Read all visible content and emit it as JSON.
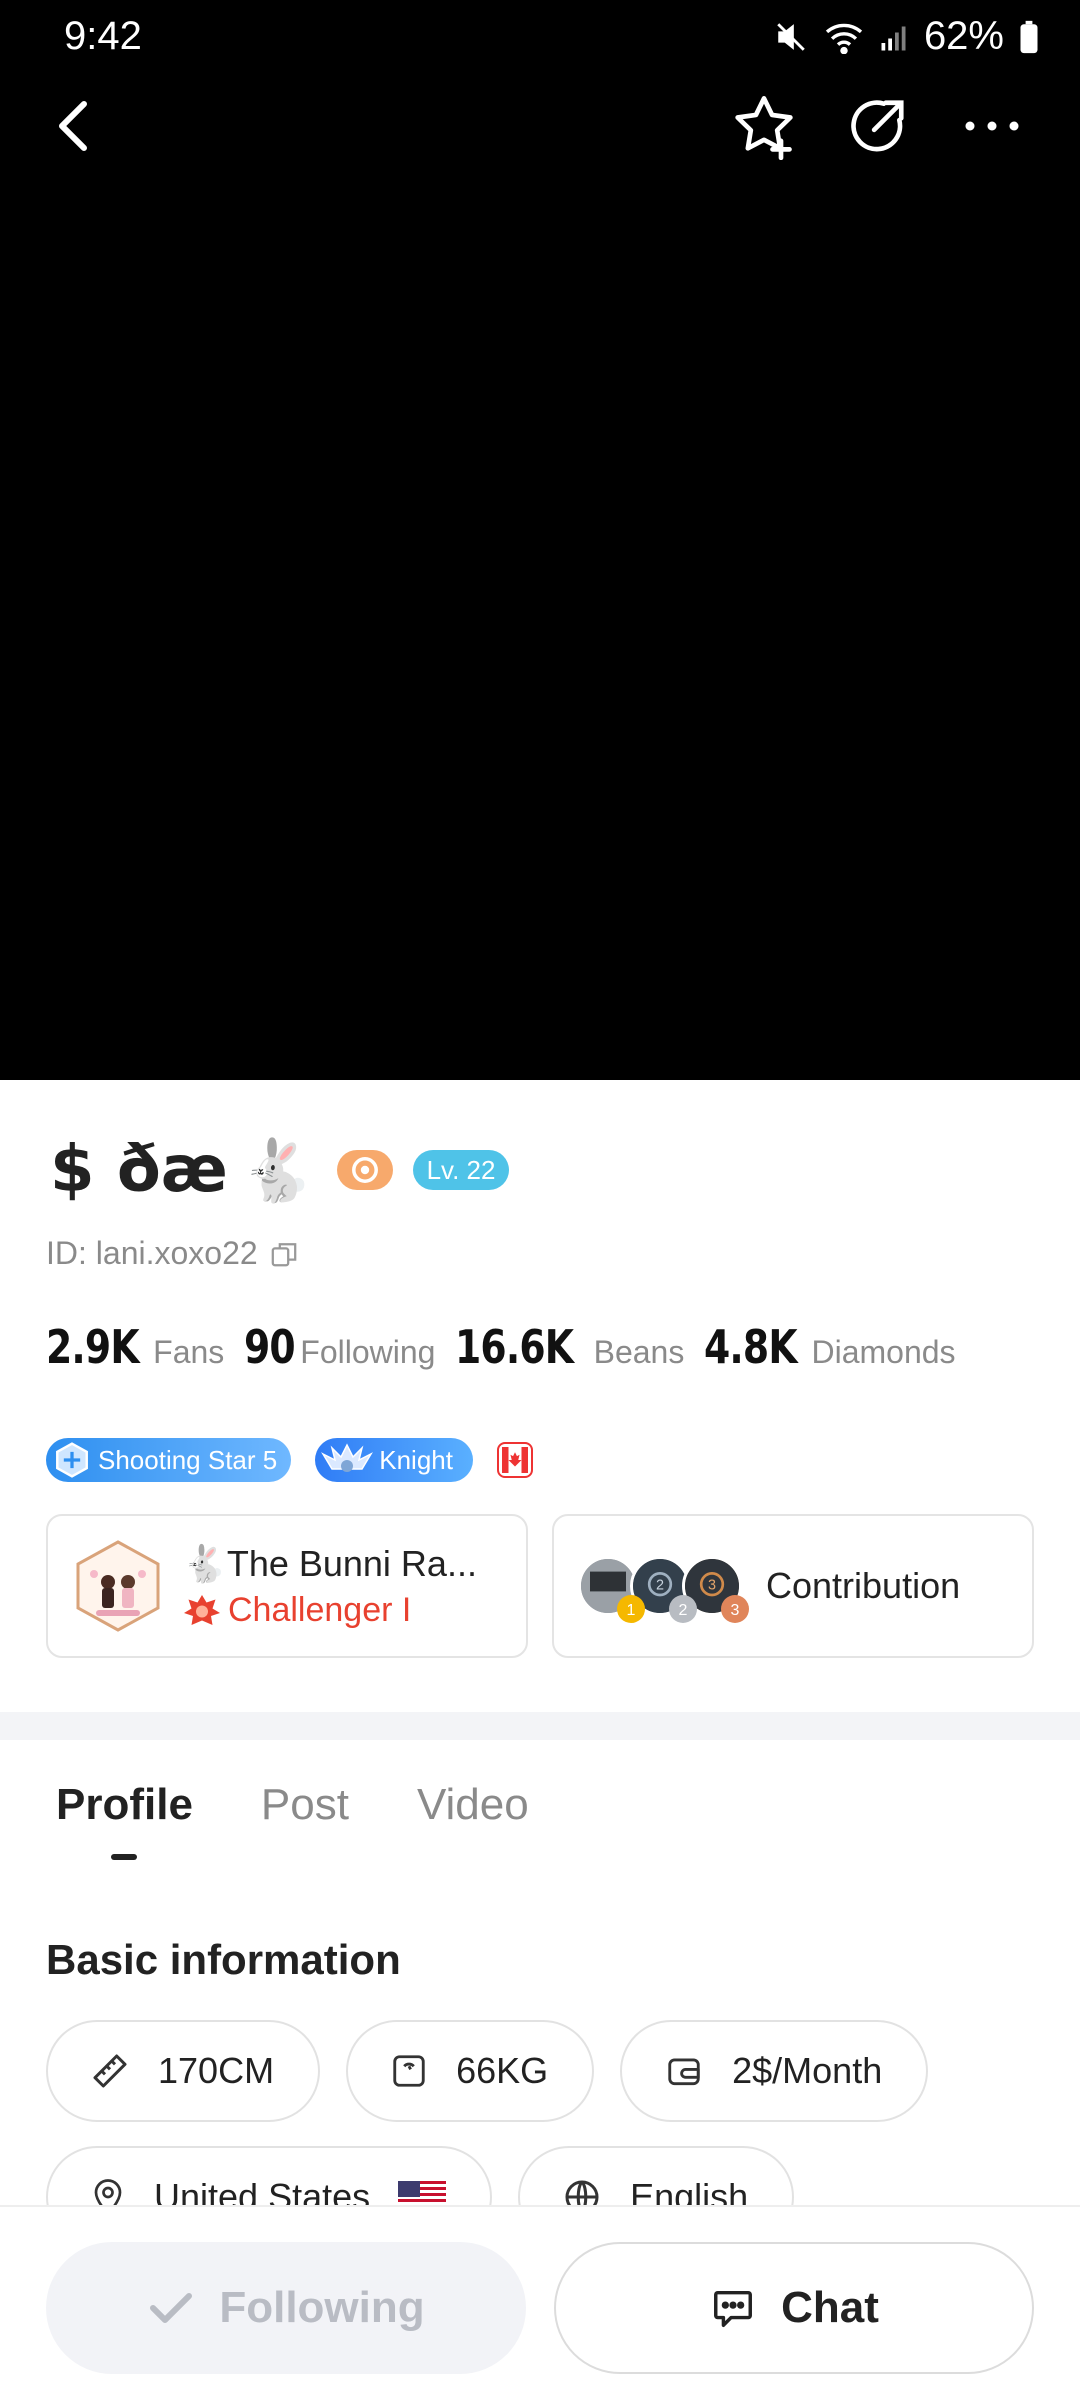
{
  "status": {
    "time": "9:42",
    "battery": "62%"
  },
  "profile": {
    "name": "$ ðæ",
    "emoji": "🐇",
    "level": "Lv. 22",
    "id_text": "ID: lani.xoxo22"
  },
  "stats": [
    {
      "value": "2.9K",
      "label": "Fans"
    },
    {
      "value": "90",
      "label": "Following"
    },
    {
      "value": "16.6K",
      "label": "Beans"
    },
    {
      "value": "4.8K",
      "label": "Diamonds"
    }
  ],
  "badges": {
    "shooting_star": "Shooting Star 5",
    "knight": "Knight"
  },
  "family": {
    "name": "🐇The Bunni Ra...",
    "rank": "Challenger I"
  },
  "contribution": {
    "label": "Contribution",
    "ranks": [
      "1",
      "2",
      "3"
    ]
  },
  "tabs": [
    "Profile",
    "Post",
    "Video"
  ],
  "basic_info": {
    "title": "Basic information",
    "height": "170CM",
    "weight": "66KG",
    "price": "2$/Month",
    "country": "United States",
    "language": "English"
  },
  "actions": {
    "following": "Following",
    "chat": "Chat"
  },
  "colors": {
    "cover": "#000000",
    "level_badge": "#4fc3e8",
    "rank_red": "#e8412f",
    "badge_blue": "#2f7cf6"
  }
}
